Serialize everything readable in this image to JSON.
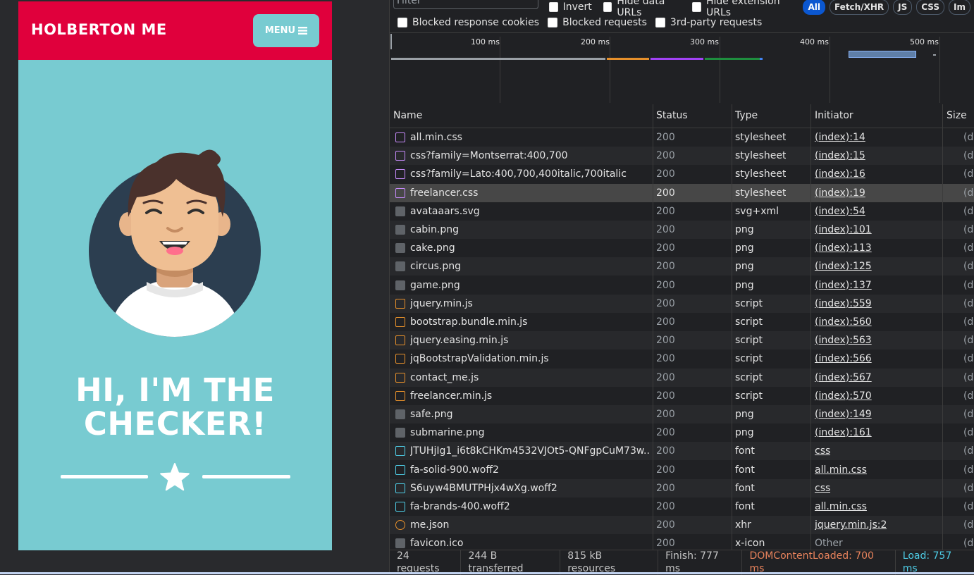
{
  "page": {
    "brand": "HOLBERTON ME",
    "menu_label": "MENU",
    "hero_line1": "HI, I'M THE",
    "hero_line2": "CHECKER!"
  },
  "colors": {
    "nav": "#e0003c",
    "teal": "#78cbd1",
    "css_icon": "#c58af9",
    "js_icon": "#e6902b",
    "font_icon": "#4ecde6",
    "dcl": "#e8835c",
    "load": "#4ecde6"
  },
  "filters": {
    "filter_placeholder": "Filter",
    "invert": "Invert",
    "hide_data_urls": "Hide data URLs",
    "hide_extension_urls": "Hide extension URLs",
    "chips": [
      "All",
      "Fetch/XHR",
      "JS",
      "CSS",
      "Im"
    ],
    "blocked_cookies": "Blocked response cookies",
    "blocked_requests": "Blocked requests",
    "third_party": "3rd-party requests"
  },
  "timeline": {
    "ticks": [
      "100 ms",
      "200 ms",
      "300 ms",
      "400 ms",
      "500 ms"
    ]
  },
  "table": {
    "headers": {
      "name": "Name",
      "status": "Status",
      "type": "Type",
      "initiator": "Initiator",
      "size": "Size"
    },
    "rows": [
      {
        "name": "all.min.css",
        "status": "200",
        "type": "stylesheet",
        "initiator": "(index):14",
        "size": "(di",
        "icon": "css-icon"
      },
      {
        "name": "css?family=Montserrat:400,700",
        "status": "200",
        "type": "stylesheet",
        "initiator": "(index):15",
        "size": "(di",
        "icon": "css-icon"
      },
      {
        "name": "css?family=Lato:400,700,400italic,700italic",
        "status": "200",
        "type": "stylesheet",
        "initiator": "(index):16",
        "size": "(di",
        "icon": "css-icon"
      },
      {
        "name": "freelancer.css",
        "status": "200",
        "type": "stylesheet",
        "initiator": "(index):19",
        "size": "(di",
        "icon": "css-icon"
      },
      {
        "name": "avataaars.svg",
        "status": "200",
        "type": "svg+xml",
        "initiator": "(index):54",
        "size": "(di",
        "icon": "image-icon"
      },
      {
        "name": "cabin.png",
        "status": "200",
        "type": "png",
        "initiator": "(index):101",
        "size": "(di",
        "icon": "image-icon"
      },
      {
        "name": "cake.png",
        "status": "200",
        "type": "png",
        "initiator": "(index):113",
        "size": "(di",
        "icon": "image-icon"
      },
      {
        "name": "circus.png",
        "status": "200",
        "type": "png",
        "initiator": "(index):125",
        "size": "(di",
        "icon": "image-icon"
      },
      {
        "name": "game.png",
        "status": "200",
        "type": "png",
        "initiator": "(index):137",
        "size": "(di",
        "icon": "image-icon"
      },
      {
        "name": "jquery.min.js",
        "status": "200",
        "type": "script",
        "initiator": "(index):559",
        "size": "(di",
        "icon": "script-icon"
      },
      {
        "name": "bootstrap.bundle.min.js",
        "status": "200",
        "type": "script",
        "initiator": "(index):560",
        "size": "(di",
        "icon": "script-icon"
      },
      {
        "name": "jquery.easing.min.js",
        "status": "200",
        "type": "script",
        "initiator": "(index):563",
        "size": "(di",
        "icon": "script-icon"
      },
      {
        "name": "jqBootstrapValidation.min.js",
        "status": "200",
        "type": "script",
        "initiator": "(index):566",
        "size": "(di",
        "icon": "script-icon"
      },
      {
        "name": "contact_me.js",
        "status": "200",
        "type": "script",
        "initiator": "(index):567",
        "size": "(di",
        "icon": "script-icon"
      },
      {
        "name": "freelancer.min.js",
        "status": "200",
        "type": "script",
        "initiator": "(index):570",
        "size": "(di",
        "icon": "script-icon"
      },
      {
        "name": "safe.png",
        "status": "200",
        "type": "png",
        "initiator": "(index):149",
        "size": "(di",
        "icon": "image-icon"
      },
      {
        "name": "submarine.png",
        "status": "200",
        "type": "png",
        "initiator": "(index):161",
        "size": "(di",
        "icon": "image-icon"
      },
      {
        "name": "JTUHjIg1_i6t8kCHKm4532VJOt5-QNFgpCuM73w...",
        "status": "200",
        "type": "font",
        "initiator": "css",
        "size": "(di",
        "icon": "font-icon"
      },
      {
        "name": "fa-solid-900.woff2",
        "status": "200",
        "type": "font",
        "initiator": "all.min.css",
        "size": "(di",
        "icon": "font-icon"
      },
      {
        "name": "S6uyw4BMUTPHjx4wXg.woff2",
        "status": "200",
        "type": "font",
        "initiator": "css",
        "size": "(di",
        "icon": "font-icon"
      },
      {
        "name": "fa-brands-400.woff2",
        "status": "200",
        "type": "font",
        "initiator": "all.min.css",
        "size": "(di",
        "icon": "font-icon"
      },
      {
        "name": "me.json",
        "status": "200",
        "type": "xhr",
        "initiator": "jquery.min.js:2",
        "size": "(di",
        "icon": "xhr-icon"
      },
      {
        "name": "favicon.ico",
        "status": "200",
        "type": "x-icon",
        "initiator": "Other",
        "size": "(di",
        "icon": "image-icon"
      }
    ]
  },
  "status_bar": {
    "requests": "24 requests",
    "transferred": "244 B transferred",
    "resources": "815 kB resources",
    "finish": "Finish: 777 ms",
    "dcl": "DOMContentLoaded: 700 ms",
    "load": "Load: 757 ms"
  }
}
